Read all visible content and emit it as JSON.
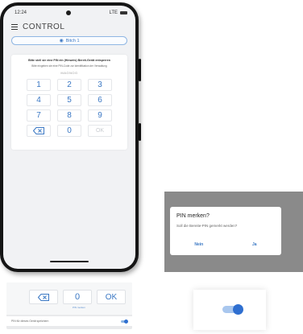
{
  "status_bar": {
    "time": "12:24",
    "network": "LTE"
  },
  "app": {
    "logo": "CONTROL"
  },
  "room_selector": {
    "label": "Bitch 1"
  },
  "pin_entry": {
    "title": "Bitte stell sie eine PIN ein (Hinweis) Bereit-Gerät entsperren",
    "subtitle": "Bitte eingeben sie eine PIN-Code zur Identifikation der Verwaltung",
    "pin_display": "MAGNOG",
    "keys": [
      "1",
      "2",
      "3",
      "4",
      "5",
      "6",
      "7",
      "8",
      "9",
      "",
      "0",
      "OK"
    ]
  },
  "dialog": {
    "title": "PIN merken?",
    "message": "Soll die Bereite-PIN gemerkt werden?",
    "no_label": "Nein",
    "yes_label": "Ja"
  },
  "detail": {
    "key_zero": "0",
    "key_ok": "OK",
    "caption": "PIN merken",
    "remember_label": "PIN für dieses Gerät speichern"
  },
  "toggle": {
    "state": "on"
  },
  "colors": {
    "accent": "#3b78c4",
    "toggle_track": "#a9c7ee",
    "toggle_knob": "#2f6fd0"
  },
  "icons": [
    "hamburger-icon",
    "wifi-icon",
    "backspace-icon",
    "battery-icon"
  ]
}
